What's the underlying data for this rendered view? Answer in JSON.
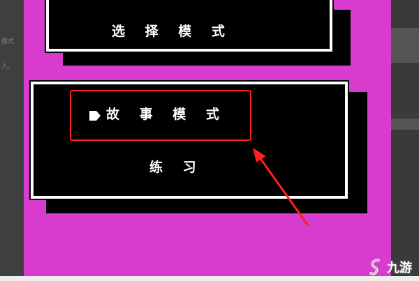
{
  "background_page": {
    "left_fragments": [
      "模式",
      "人。"
    ]
  },
  "game": {
    "background_color": "#d83ccf",
    "top_panel": {
      "label": "选 择 模 式"
    },
    "main_panel": {
      "selected_item": "故 事 模 式",
      "second_item": "练 习"
    },
    "cursor_icon": "pointer-arrow-icon"
  },
  "annotation": {
    "highlight_color": "#ff1f1f",
    "arrow_color": "#ff1f1f"
  },
  "watermark": {
    "logo_icon": "jiuyou-logo-icon",
    "text": "九游"
  }
}
